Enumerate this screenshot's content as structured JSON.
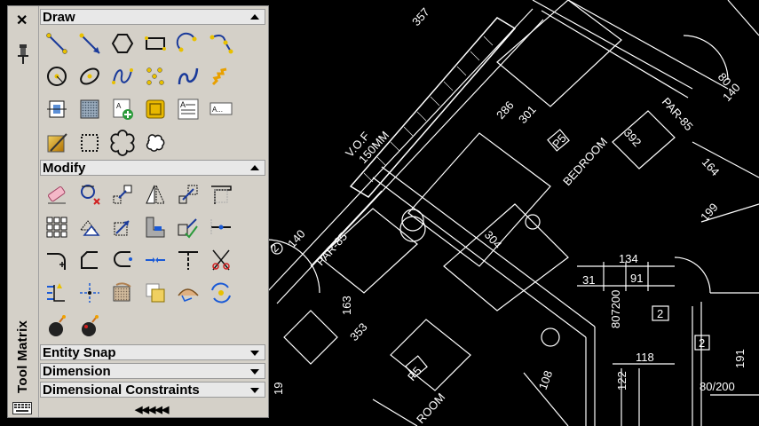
{
  "palette": {
    "title": "Tool Matrix",
    "close_glyph": "✕",
    "more_indicator": "◀◀◀◀◀",
    "sections": [
      {
        "label": "Draw",
        "state": "expanded"
      },
      {
        "label": "Modify",
        "state": "expanded"
      },
      {
        "label": "Entity Snap",
        "state": "collapsed"
      },
      {
        "label": "Dimension",
        "state": "collapsed"
      },
      {
        "label": "Dimensional Constraints",
        "state": "collapsed"
      }
    ],
    "draw_tools": [
      "line",
      "ray",
      "polygon",
      "rectangle",
      "arc",
      "polyline",
      "circle",
      "ellipse",
      "spline",
      "point-cloud",
      "revision-curve",
      "helix",
      "region",
      "hatch",
      "add-block",
      "block-insert",
      "multiline-text",
      "single-line-text",
      "gradient",
      "boundary",
      "wipeout",
      "cloud"
    ],
    "modify_tools": [
      "erase",
      "copy",
      "move",
      "mirror",
      "scale",
      "stretch",
      "array",
      "offset",
      "rotate",
      "align",
      "extend",
      "break-at-point",
      "fillet",
      "chamfer",
      "blend",
      "join",
      "break",
      "trim",
      "explode-edit",
      "revcloud",
      "overkill",
      "draworder",
      "edit-attributes",
      "edit-xref",
      "explode",
      "burst"
    ]
  },
  "drawing": {
    "labels": [
      "357",
      "V.O.F",
      "150MM",
      "286",
      "301",
      "P5",
      "BEDROOM",
      "392",
      "PAR-85",
      "80",
      "140",
      "164",
      "199",
      "140",
      "PAR-85",
      "2",
      "304",
      "163",
      "353",
      "134",
      "31",
      "91",
      "807200",
      "2",
      "2",
      "118",
      "122",
      "191",
      "108",
      "80/200",
      "19",
      "P5",
      "ROOM"
    ]
  }
}
